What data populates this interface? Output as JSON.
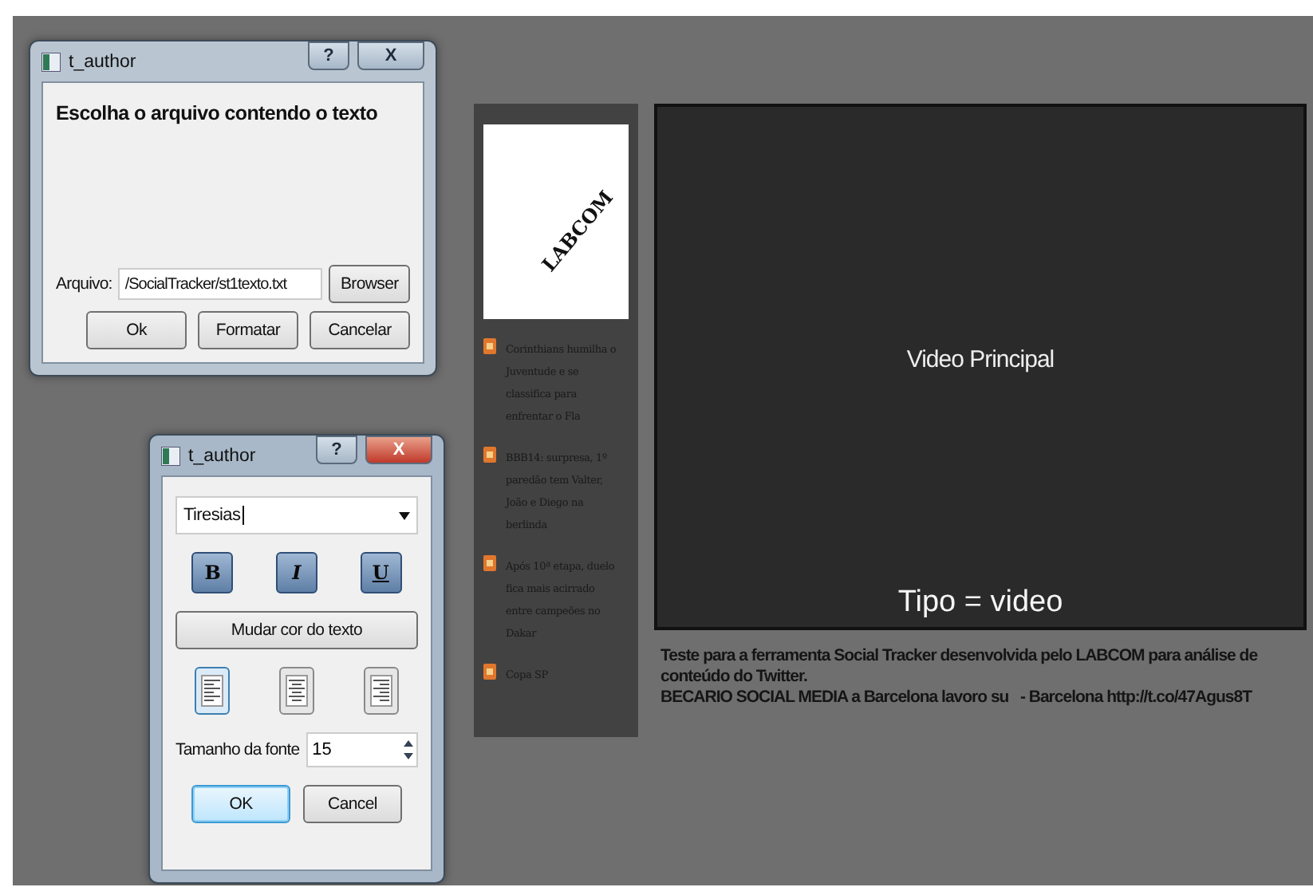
{
  "file_dialog": {
    "title": "t_author",
    "active": false,
    "help": "?",
    "close": "X",
    "heading": "Escolha o arquivo contendo o texto",
    "file_label": "Arquivo:",
    "file_value": "/SocialTracker/st1texto.txt",
    "browse_button": "Browser",
    "buttons": [
      "Ok",
      "Formatar",
      "Cancelar"
    ]
  },
  "format_dialog": {
    "title": "t_author",
    "active": true,
    "help": "?",
    "close": "X",
    "font_value": "Tiresias",
    "style_buttons": [
      {
        "label": "B",
        "kind": "bold",
        "checked": true
      },
      {
        "label": "I",
        "kind": "italic",
        "checked": true
      },
      {
        "label": "U",
        "kind": "underline",
        "checked": true
      }
    ],
    "color_button": "Mudar cor do texto",
    "align_buttons": [
      {
        "kind": "left",
        "selected": true
      },
      {
        "kind": "center",
        "selected": false
      },
      {
        "kind": "right",
        "selected": false
      }
    ],
    "size_label": "Tamanho da fonte",
    "size_value": "15",
    "buttons": [
      {
        "label": "OK",
        "default": true
      },
      {
        "label": "Cancel",
        "default": false
      }
    ]
  },
  "feed": {
    "logo_text": "LABCOM",
    "items": [
      "Corinthians humilha o Juventude e se classifica para enfrentar o Fla",
      "BBB14: surpresa, 1º paredão tem Valter, João e Diego na berlinda",
      "Após 10ª etapa, duelo fica mais acirrado entre campeões no Dakar",
      "Copa SP"
    ]
  },
  "video": {
    "title": "Video Principal",
    "type_label": "Tipo = video"
  },
  "caption": {
    "description": "Teste para a ferramenta Social Tracker desenvolvida pelo LABCOM para análise de conteúdo do Twitter.",
    "tweet": "BECARIO SOCIAL MEDIA a Barcelona lavoro su   - Barcelona http://t.co/47Agus8T"
  }
}
